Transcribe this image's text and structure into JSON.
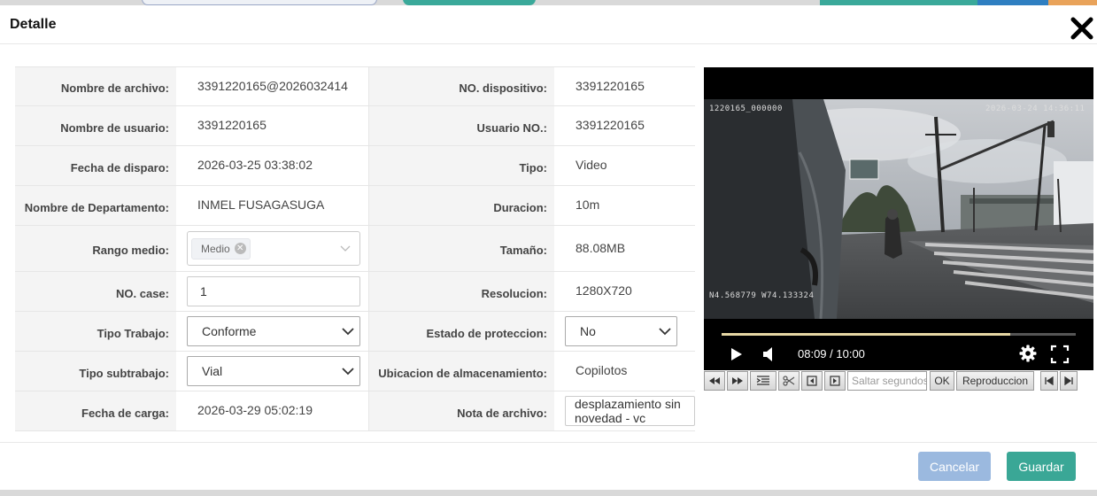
{
  "modal": {
    "title": "Detalle"
  },
  "rows": {
    "r1": {
      "l1": "Nombre de archivo:",
      "v1": "3391220165@2026032414",
      "l2": "NO. dispositivo:",
      "v2": "3391220165"
    },
    "r2": {
      "l1": "Nombre de usuario:",
      "v1": "3391220165",
      "l2": "Usuario NO.:",
      "v2": "3391220165"
    },
    "r3": {
      "l1": "Fecha de disparo:",
      "v1": "2026-03-25 03:38:02",
      "l2": "Tipo:",
      "v2": "Video"
    },
    "r4": {
      "l1": "Nombre de Departamento:",
      "v1": "INMEL FUSAGASUGA",
      "l2": "Duracion:",
      "v2": "10m"
    },
    "r5": {
      "l1": "Rango medio:",
      "tag": "Medio",
      "l2": "Tamaño:",
      "v2": "88.08MB"
    },
    "r6": {
      "l1": "NO. case:",
      "input": "1",
      "l2": "Resolucion:",
      "v2": "1280X720"
    },
    "r7": {
      "l1": "Tipo Trabajo:",
      "select": "Conforme",
      "l2": "Estado de proteccion:",
      "select2": "No"
    },
    "r8": {
      "l1": "Tipo subtrabajo:",
      "select": "Vial",
      "l2": "Ubicacion de almacenamiento:",
      "v2": "Copilotos"
    },
    "r9": {
      "l1": "Fecha de carga:",
      "v1": "2026-03-29 05:02:19",
      "l2": "Nota de archivo:",
      "note": "desplazamiento sin novedad - vc"
    }
  },
  "video": {
    "osd_device": "1220165_000000",
    "osd_datetime": "2026-03-24 14:36:11",
    "osd_gps": "N4.568779  W74.133324",
    "time": "08:09 / 10:00",
    "progress": 0.815
  },
  "toolbar": {
    "seek_placeholder": "Saltar segundos",
    "ok_label": "OK",
    "play_label": "Reproduccion"
  },
  "footer": {
    "cancel_label": "Cancelar",
    "save_label": "Guardar"
  },
  "colors": {
    "primary": "#3aa796",
    "cancel": "#9bb9df"
  }
}
